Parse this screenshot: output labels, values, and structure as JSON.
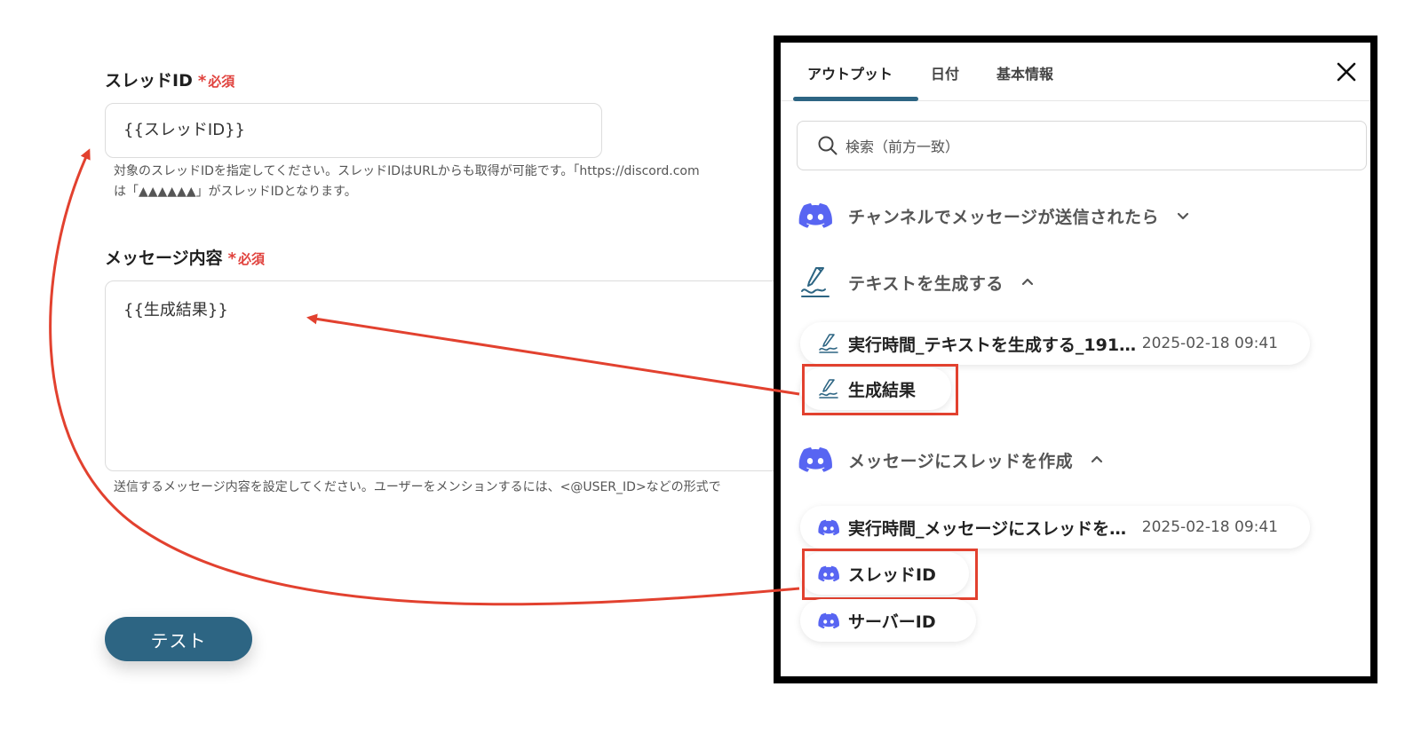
{
  "form": {
    "thread_id": {
      "label": "スレッドID",
      "required": "必須",
      "value": "{{スレッドID}}",
      "help_line1": "対象のスレッドIDを指定してください。スレッドIDはURLからも取得が可能です。「https://discord.com",
      "help_line2": "は「▲▲▲▲▲▲」がスレッドIDとなります。"
    },
    "message": {
      "label": "メッセージ内容",
      "required": "必須",
      "value": "{{生成結果}}",
      "help": "送信するメッセージ内容を設定してください。ユーザーをメンションするには、<@USER_ID>などの形式で"
    },
    "test_button": "テスト"
  },
  "panel": {
    "tabs": [
      "アウトプット",
      "日付",
      "基本情報"
    ],
    "active_tab": "アウトプット",
    "search_placeholder": "検索（前方一致）",
    "sections": [
      {
        "title": "チャンネルでメッセージが送信されたら",
        "icon": "discord-icon",
        "expanded": false
      },
      {
        "title": "テキストを生成する",
        "icon": "ai-pen-icon",
        "expanded": true
      },
      {
        "title": "メッセージにスレッドを作成",
        "icon": "discord-icon",
        "expanded": true
      }
    ],
    "items": {
      "gen_exec_time": {
        "label": "実行時間_テキストを生成する_191…",
        "time": "2025-02-18 09:41"
      },
      "gen_result": {
        "label": "生成結果"
      },
      "thread_exec_time": {
        "label": "実行時間_メッセージにスレッドを…",
        "time": "2025-02-18 09:41"
      },
      "thread_id": {
        "label": "スレッドID"
      },
      "server_id": {
        "label": "サーバーID"
      }
    }
  },
  "colors": {
    "accent": "#2d6583",
    "required": "#e0413c",
    "highlight": "#e2412f",
    "discord": "#5865f2"
  }
}
